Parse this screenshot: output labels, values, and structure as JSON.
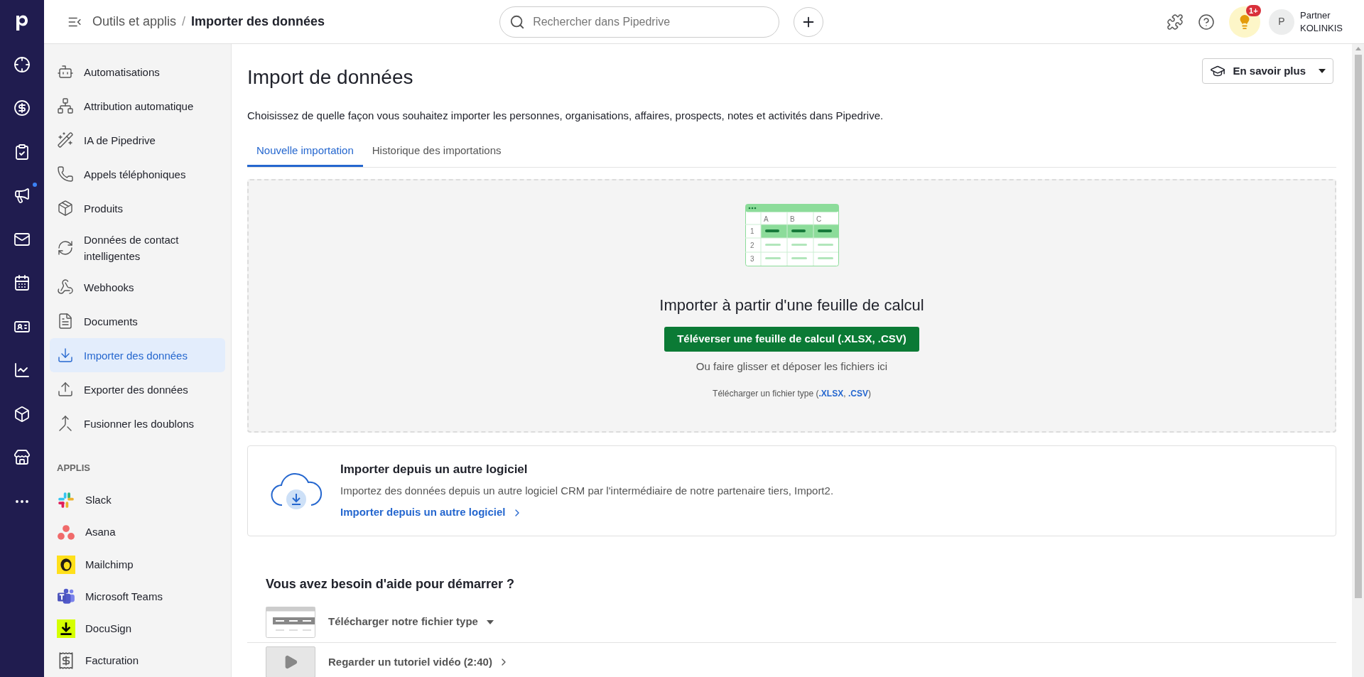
{
  "nav_rail": [
    {
      "notification": false
    },
    {
      "notification": false
    },
    {
      "notification": false
    },
    {
      "notification": true
    },
    {
      "notification": false
    },
    {
      "notification": false
    },
    {
      "notification": false
    },
    {
      "notification": false
    },
    {
      "notification": false
    },
    {
      "notification": false
    },
    {
      "notification": false
    }
  ],
  "header": {
    "breadcrumb": [
      "Outils et applis",
      "Importer des données"
    ],
    "separator": "/",
    "search": {
      "placeholder": "Rechercher dans Pipedrive"
    },
    "tips_badge": "1+",
    "user": {
      "initial": "P",
      "name": "Partner",
      "company": "KOLINKIS"
    }
  },
  "sidebar": {
    "tools": [
      {
        "label": "Automatisations",
        "selected": false
      },
      {
        "label": "Attribution automatique",
        "selected": false
      },
      {
        "label": "IA de Pipedrive",
        "selected": false
      },
      {
        "label": "Appels téléphoniques",
        "selected": false
      },
      {
        "label": "Produits",
        "selected": false
      },
      {
        "label": "Données de contact intelligentes",
        "selected": false
      },
      {
        "label": "Webhooks",
        "selected": false
      },
      {
        "label": "Documents",
        "selected": false
      },
      {
        "label": "Importer des données",
        "selected": true
      },
      {
        "label": "Exporter des données",
        "selected": false
      },
      {
        "label": "Fusionner les doublons",
        "selected": false
      }
    ],
    "apps_heading": "APPLIS",
    "apps": [
      {
        "label": "Slack"
      },
      {
        "label": "Asana"
      },
      {
        "label": "Mailchimp"
      },
      {
        "label": "Microsoft Teams"
      },
      {
        "label": "DocuSign"
      },
      {
        "label": "Facturation"
      }
    ]
  },
  "page": {
    "title": "Import de données",
    "learn_more": "En savoir plus",
    "description": "Choisissez de quelle façon vous souhaitez importer les personnes, organisations, affaires, prospects, notes et activités dans Pipedrive.",
    "tabs": [
      {
        "label": "Nouvelle importation",
        "selected": true
      },
      {
        "label": "Historique des importations",
        "selected": false
      }
    ],
    "dropzone": {
      "sheet_columns": [
        "A",
        "B",
        "C"
      ],
      "sheet_rows": [
        "1",
        "2",
        "3"
      ],
      "heading": "Importer à partir d'une feuille de calcul",
      "button": "Téléverser une feuille de calcul (.XLSX, .CSV)",
      "hint": "Ou faire glisser et déposer les fichiers ici",
      "template_note": {
        "before": "Télécharger un fichier type (",
        "links": [
          ".XLSX",
          ".CSV"
        ],
        "between": ", ",
        "after": ")"
      }
    },
    "other_software": {
      "title": "Importer depuis un autre logiciel",
      "description": "Importez des données depuis un autre logiciel CRM par l'intermédiaire de notre partenaire tiers, Import2.",
      "link": "Importer depuis un autre logiciel"
    },
    "help": {
      "title": "Vous avez besoin d'aide pour démarrer ?",
      "items": [
        {
          "kind": "download",
          "label": "Télécharger notre fichier type"
        },
        {
          "kind": "video",
          "label": "Regarder un tutoriel vidéo (2:40)"
        }
      ]
    }
  }
}
